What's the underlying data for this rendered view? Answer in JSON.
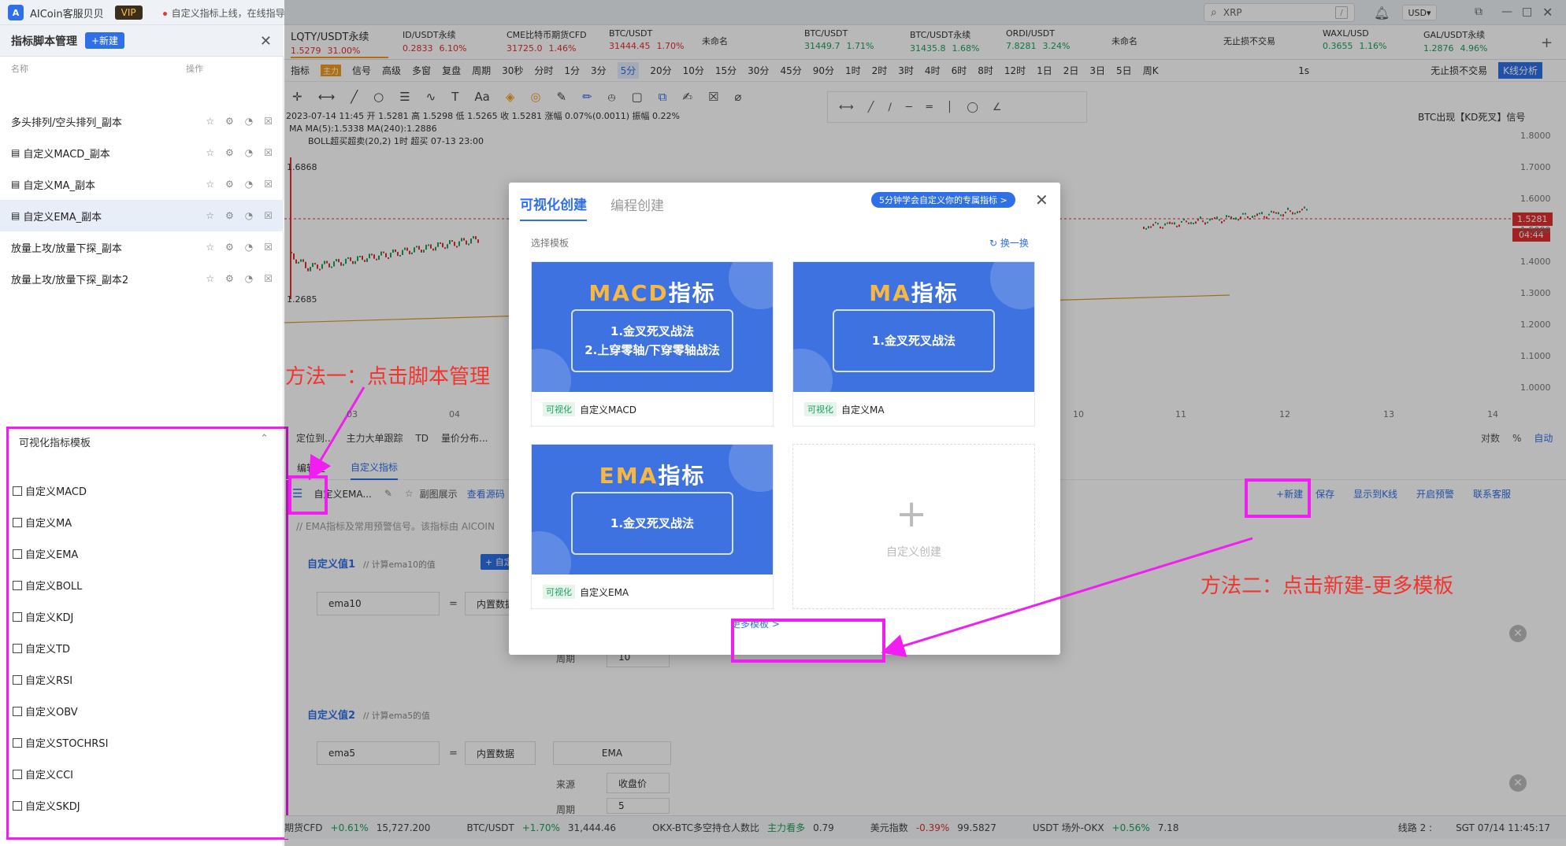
{
  "titlebar": {
    "app_name": "AICoin客服贝贝",
    "vip": "VIP",
    "notice": "自定义指标上线，在线指导",
    "search_value": "XRP",
    "search_key": "/",
    "currency": "USD"
  },
  "sidebar": {
    "title": "指标脚本管理",
    "new_label": "+新建",
    "col_name": "名称",
    "col_action": "操作",
    "items": [
      {
        "label": "多头排列/空头排列_副本"
      },
      {
        "label": "自定义MACD_副本"
      },
      {
        "label": "自定义MA_副本"
      },
      {
        "label": "自定义EMA_副本"
      },
      {
        "label": "放量上攻/放量下探_副本"
      },
      {
        "label": "放量上攻/放量下探_副本2"
      }
    ],
    "templates_title": "可视化指标模板",
    "templates": [
      "自定义MACD",
      "自定义MA",
      "自定义EMA",
      "自定义BOLL",
      "自定义KDJ",
      "自定义TD",
      "自定义RSI",
      "自定义OBV",
      "自定义STOCHRSI",
      "自定义CCI",
      "自定义SKDJ"
    ]
  },
  "tickers": [
    {
      "name": "LQTY/USDT永续",
      "price": "1.5279",
      "change": "31.00%",
      "dir": "up"
    },
    {
      "name": "ID/USDT永续",
      "price": "0.2833",
      "change": "6.10%",
      "dir": "up"
    },
    {
      "name": "CME比特币期货CFD",
      "price": "31725.0",
      "change": "1.46%",
      "dir": "up"
    },
    {
      "name": "BTC/USDT",
      "price": "31444.45",
      "change": "1.70%",
      "dir": "up"
    },
    {
      "name": "未命名",
      "price": "",
      "change": "",
      "dir": "none"
    },
    {
      "name": "BTC/USDT",
      "price": "31449.7",
      "change": "1.71%",
      "dir": "gr"
    },
    {
      "name": "BTC/USDT永续",
      "price": "31435.8",
      "change": "1.68%",
      "dir": "gr"
    },
    {
      "name": "ORDI/USDT",
      "price": "7.8281",
      "change": "3.24%",
      "dir": "gr"
    },
    {
      "name": "未命名",
      "price": "",
      "change": "",
      "dir": "none"
    },
    {
      "name": "无止损不交易",
      "price": "",
      "change": "",
      "dir": "none"
    },
    {
      "name": "WAXL/USD",
      "price": "0.3655",
      "change": "1.16%",
      "dir": "gr"
    },
    {
      "name": "GAL/USDT永续",
      "price": "1.2876",
      "change": "4.96%",
      "dir": "gr"
    }
  ],
  "toolbar": {
    "items": [
      "指标",
      "信号",
      "高级",
      "多窗",
      "复盘",
      "周期",
      "30秒",
      "分时",
      "1分",
      "3分",
      "5分",
      "20分",
      "10分",
      "15分",
      "30分",
      "45分",
      "90分",
      "1时",
      "2时",
      "3时",
      "4时",
      "6时",
      "8时",
      "12时",
      "1日",
      "2日",
      "3日",
      "5日",
      "周K"
    ],
    "active": "5分",
    "main_tag": "主力",
    "right_interval": "1s",
    "no_stop": "无止损不交易",
    "kline_analysis": "K线分析"
  },
  "chart": {
    "info_line1": "2023-07-14 11:45 开 1.5281 高 1.5298 低 1.5265 收 1.5281 涨幅 0.07%(0.0011) 振幅 0.22%",
    "info_line2": "MA MA(5):1.5338 MA(240):1.2886",
    "info_line3": "BOLL超买超卖(20,2) 1时 超买 07-13 23:00",
    "signal": "BTC出现【KD死叉】信号",
    "high_label": "1.6868",
    "low_label": "1.2685",
    "price_tag": "1.5281",
    "time_tag": "04:44",
    "y_ticks": [
      "1.8000",
      "1.7000",
      "1.6000",
      "1.5000",
      "1.4000",
      "1.3000",
      "1.2000",
      "1.1000",
      "1.0000"
    ],
    "x_ticks": [
      "03",
      "04",
      "10",
      "11",
      "12",
      "13",
      "14"
    ],
    "scale_log": "对数",
    "scale_pct": "%",
    "scale_auto": "自动"
  },
  "lower": {
    "bar_items": [
      "定位到...",
      "主力大单跟踪",
      "TD",
      "量价分布..."
    ],
    "tab_area": "编辑区",
    "tab_custom": "自定义指标",
    "script_name": "自定义EMA...",
    "sub_show": "副图展示",
    "view": "查看源码",
    "desc": "// EMA指标及常用预警信号。该指标由 AICOIN",
    "btn_new": "+新建",
    "btn_save": "保存",
    "btn_show": "显示到K线",
    "btn_alert": "开启预警",
    "btn_service": "联系客服",
    "sec1_title": "自定义值1",
    "sec1_comment": "// 计算ema10的值",
    "sec1_add": "+ 自定义",
    "sec1_var": "ema10",
    "sec1_src": "内置数据",
    "period_label": "周期",
    "period_value": "10",
    "sec2_title": "自定义值2",
    "sec2_comment": "// 计算ema5的值",
    "sec2_var": "ema5",
    "sec2_src": "内置数据",
    "sec2_fn": "EMA",
    "source_label": "来源",
    "source_value": "收盘价",
    "period2_label": "周期",
    "period2_value": "5",
    "eq": "="
  },
  "statusbar": {
    "items": [
      {
        "name": "期货CFD",
        "chg": "+0.61%",
        "val": "15,727.200",
        "dir": "gr"
      },
      {
        "name": "BTC/USDT",
        "chg": "+1.70%",
        "val": "31,444.46",
        "dir": "gr"
      },
      {
        "name": "OKX-BTC多空持仓人数比",
        "chg": "主力看多",
        "val": "0.79",
        "dir": "gr"
      },
      {
        "name": "美元指数",
        "chg": "-0.39%",
        "val": "99.5827",
        "dir": "up"
      },
      {
        "name": "USDT 场外-OKX",
        "chg": "+0.56%",
        "val": "7.18",
        "dir": "gr"
      }
    ],
    "line": "线路 2 :",
    "time": "SGT 07/14 11:45:17"
  },
  "modal": {
    "tab_visual": "可视化创建",
    "tab_code": "编程创建",
    "banner": "5分钟学会自定义你的专属指标 >",
    "subtitle": "选择模板",
    "shuffle": "换一换",
    "cards": [
      {
        "title_hl": "MACD",
        "title_rest": "指标",
        "lines": [
          "1.金叉死叉战法",
          "2.上穿零轴/下穿零轴战法"
        ],
        "tag": "可视化",
        "name": "自定义MACD"
      },
      {
        "title_hl": "MA",
        "title_rest": "指标",
        "lines": [
          "1.金叉死叉战法"
        ],
        "tag": "可视化",
        "name": "自定义MA"
      },
      {
        "title_hl": "EMA",
        "title_rest": "指标",
        "lines": [
          "1.金叉死叉战法"
        ],
        "tag": "可视化",
        "name": "自定义EMA"
      }
    ],
    "custom_create": "自定义创建",
    "more": "更多模板 >"
  },
  "annotations": {
    "method1": "方法一：点击脚本管理",
    "method2": "方法二：点击新建-更多模板"
  },
  "colors": {
    "accent": "#2f6fe8",
    "up": "#e0302f",
    "down": "#1aa25a",
    "annotation": "#f0352f",
    "highlight": "#f01ef0"
  }
}
